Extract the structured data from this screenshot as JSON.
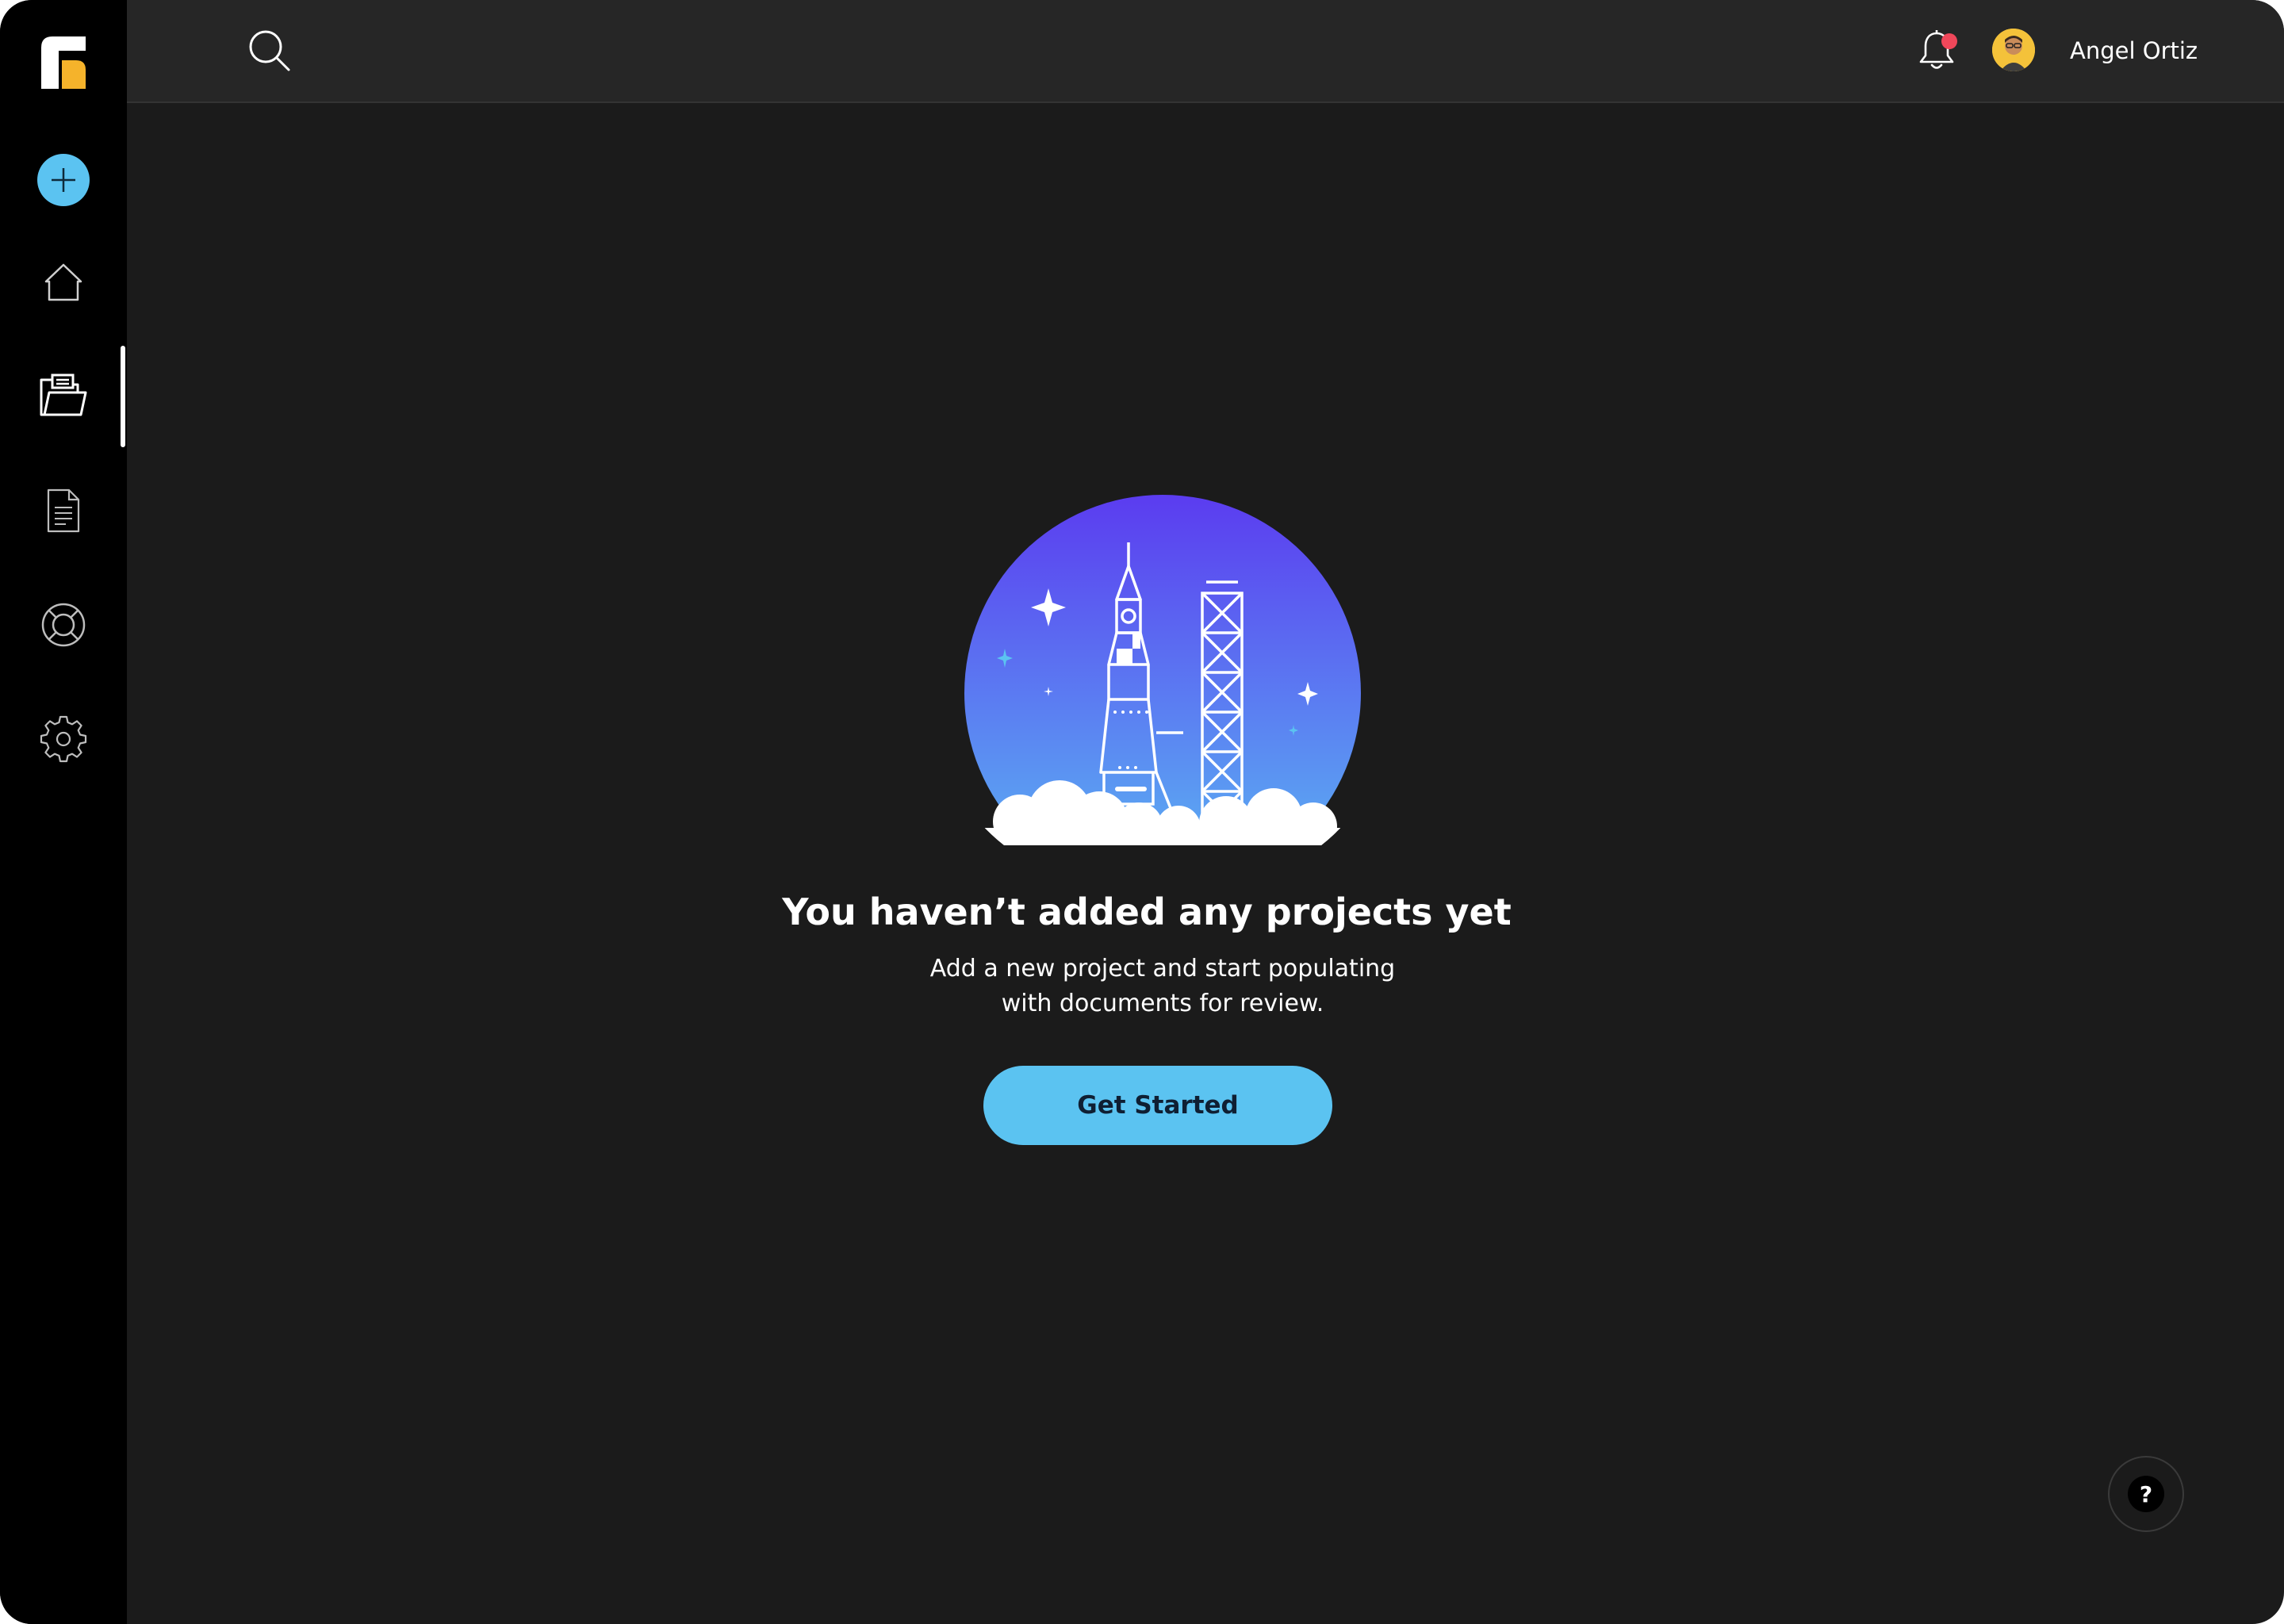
{
  "sidebar": {
    "logo": "app-logo",
    "add_button": "plus-icon",
    "items": [
      {
        "name": "home",
        "icon": "home-icon"
      },
      {
        "name": "projects",
        "icon": "folder-open-icon",
        "active": true
      },
      {
        "name": "documents",
        "icon": "document-icon"
      },
      {
        "name": "support",
        "icon": "lifebuoy-icon"
      },
      {
        "name": "settings",
        "icon": "gear-icon"
      }
    ]
  },
  "header": {
    "search_icon": "search-icon",
    "notifications_icon": "bell-icon",
    "has_unread_notifications": true,
    "user_name": "Angel Ortiz"
  },
  "empty_state": {
    "illustration": "rocket-launch-illustration",
    "title": "You haven’t added any projects yet",
    "description_line1": "Add a new project and start populating",
    "description_line2": "with documents for review.",
    "cta_label": "Get Started"
  },
  "help_button": {
    "label": "?"
  },
  "colors": {
    "accent": "#5bc3f1",
    "background": "#1b1b1b",
    "sidebar": "#000000",
    "topbar": "#262626",
    "notification_dot": "#f0475a",
    "gradient_top": "#5b3cf0",
    "gradient_bottom": "#5bb8f3"
  }
}
